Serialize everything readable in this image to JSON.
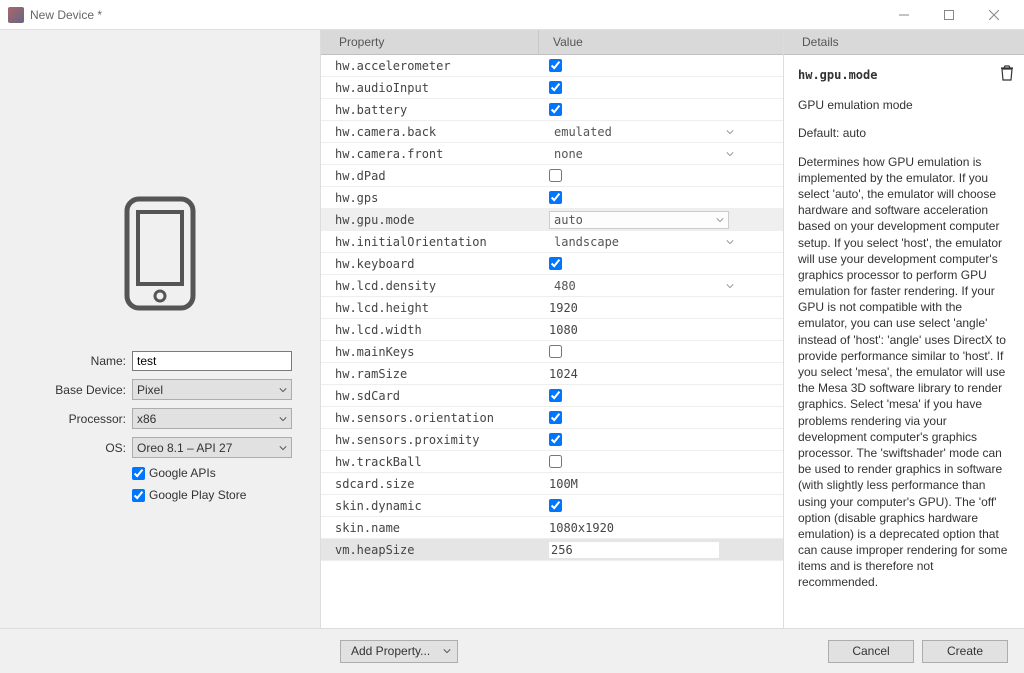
{
  "window": {
    "title": "New Device *"
  },
  "left": {
    "labels": {
      "name": "Name:",
      "base": "Base Device:",
      "proc": "Processor:",
      "os": "OS:"
    },
    "name_value": "test",
    "base_value": "Pixel",
    "proc_value": "x86",
    "os_value": "Oreo 8.1 – API 27",
    "google_apis_label": "Google APIs",
    "google_play_label": "Google Play Store"
  },
  "table": {
    "header_prop": "Property",
    "header_val": "Value",
    "rows": [
      {
        "name": "hw.accelerometer",
        "type": "check",
        "checked": true
      },
      {
        "name": "hw.audioInput",
        "type": "check",
        "checked": true
      },
      {
        "name": "hw.battery",
        "type": "check",
        "checked": true
      },
      {
        "name": "hw.camera.back",
        "type": "dropdown",
        "value": "emulated"
      },
      {
        "name": "hw.camera.front",
        "type": "dropdown",
        "value": "none"
      },
      {
        "name": "hw.dPad",
        "type": "check",
        "checked": false
      },
      {
        "name": "hw.gps",
        "type": "check",
        "checked": true
      },
      {
        "name": "hw.gpu.mode",
        "type": "dropdown",
        "value": "auto",
        "selected": true,
        "boxed": true
      },
      {
        "name": "hw.initialOrientation",
        "type": "dropdown",
        "value": "landscape"
      },
      {
        "name": "hw.keyboard",
        "type": "check",
        "checked": true
      },
      {
        "name": "hw.lcd.density",
        "type": "dropdown",
        "value": "480"
      },
      {
        "name": "hw.lcd.height",
        "type": "text",
        "value": "1920"
      },
      {
        "name": "hw.lcd.width",
        "type": "text",
        "value": "1080"
      },
      {
        "name": "hw.mainKeys",
        "type": "check",
        "checked": false
      },
      {
        "name": "hw.ramSize",
        "type": "text",
        "value": "1024"
      },
      {
        "name": "hw.sdCard",
        "type": "check",
        "checked": true
      },
      {
        "name": "hw.sensors.orientation",
        "type": "check",
        "checked": true
      },
      {
        "name": "hw.sensors.proximity",
        "type": "check",
        "checked": true
      },
      {
        "name": "hw.trackBall",
        "type": "check",
        "checked": false
      },
      {
        "name": "sdcard.size",
        "type": "text",
        "value": "100M"
      },
      {
        "name": "skin.dynamic",
        "type": "check",
        "checked": true
      },
      {
        "name": "skin.name",
        "type": "text",
        "value": "1080x1920"
      },
      {
        "name": "vm.heapSize",
        "type": "edit",
        "value": "256",
        "selected": true
      }
    ]
  },
  "details": {
    "header": "Details",
    "prop": "hw.gpu.mode",
    "line1": "GPU emulation mode",
    "line2": "Default: auto",
    "body": "Determines how GPU emulation is implemented by the emulator. If you select 'auto', the emulator will choose hardware and software acceleration based on your development computer setup. If you select 'host', the emulator will use your development computer's graphics processor to perform GPU emulation for faster rendering. If your GPU is not compatible with the emulator, you can use select 'angle' instead of 'host': 'angle' uses DirectX to provide performance similar to 'host'. If you select 'mesa', the emulator will use the Mesa 3D software library to render graphics. Select 'mesa' if you have problems rendering via your development computer's graphics processor. The 'swiftshader' mode can be used to render graphics in software (with slightly less performance than using your computer's GPU). The 'off' option (disable graphics hardware emulation) is a deprecated option that can cause improper rendering for some items and is therefore not recommended."
  },
  "footer": {
    "add_property": "Add Property...",
    "cancel": "Cancel",
    "create": "Create"
  }
}
